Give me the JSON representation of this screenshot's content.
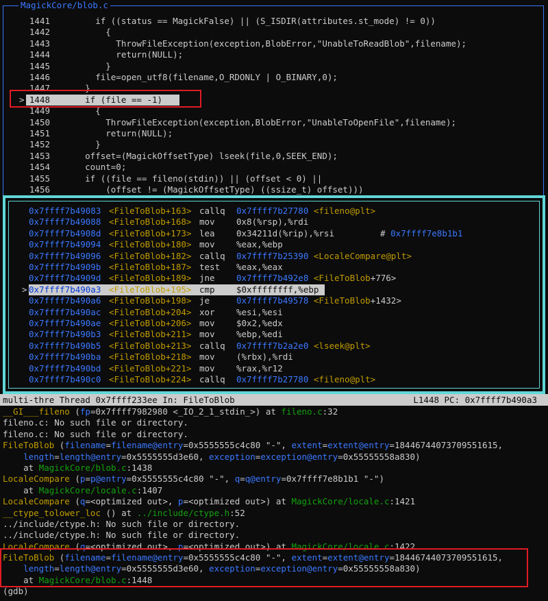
{
  "source_pane": {
    "title": "MagickCore/blob.c",
    "current_marker": ">",
    "lines": [
      {
        "num": "1441",
        "code": "        if ((status == MagickFalse) || (S_ISDIR(attributes.st_mode) != 0))"
      },
      {
        "num": "1442",
        "code": "          {"
      },
      {
        "num": "1443",
        "code": "            ThrowFileException(exception,BlobError,\"UnableToReadBlob\",filename);"
      },
      {
        "num": "1444",
        "code": "            return(NULL);"
      },
      {
        "num": "1445",
        "code": "          }"
      },
      {
        "num": "1446",
        "code": "        file=open_utf8(filename,O_RDONLY | O_BINARY,0);"
      },
      {
        "num": "1447",
        "code": "      }"
      },
      {
        "num": "1448",
        "code": "      if (file == -1)",
        "current": true
      },
      {
        "num": "1449",
        "code": "        {"
      },
      {
        "num": "1450",
        "code": "          ThrowFileException(exception,BlobError,\"UnableToOpenFile\",filename);"
      },
      {
        "num": "1451",
        "code": "          return(NULL);"
      },
      {
        "num": "1452",
        "code": "        }"
      },
      {
        "num": "1453",
        "code": "      offset=(MagickOffsetType) lseek(file,0,SEEK_END);"
      },
      {
        "num": "1454",
        "code": "      count=0;"
      },
      {
        "num": "1455",
        "code": "      if ((file == fileno(stdin)) || (offset < 0) ||"
      },
      {
        "num": "1456",
        "code": "          (offset != (MagickOffsetType) ((ssize_t) offset)))"
      }
    ]
  },
  "asm_pane": {
    "lines": [
      {
        "addr": "0x7ffff7b49083",
        "fn": "<FileToBlob+163>",
        "op": "callq",
        "target": "0x7ffff7b27780",
        "sym": "<fileno@plt>"
      },
      {
        "addr": "0x7ffff7b49088",
        "fn": "<FileToBlob+168>",
        "op": "mov",
        "args": "0x8(%rsp),%rdi"
      },
      {
        "addr": "0x7ffff7b4908d",
        "fn": "<FileToBlob+173>",
        "op": "lea",
        "args": "0x34211d(%rip),%rsi",
        "comment": "# ",
        "comment_target": "0x7ffff7e8b1b1"
      },
      {
        "addr": "0x7ffff7b49094",
        "fn": "<FileToBlob+180>",
        "op": "mov",
        "args": "%eax,%ebp"
      },
      {
        "addr": "0x7ffff7b49096",
        "fn": "<FileToBlob+182>",
        "op": "callq",
        "target": "0x7ffff7b25390",
        "sym": "<LocaleCompare@plt>"
      },
      {
        "addr": "0x7ffff7b4909b",
        "fn": "<FileToBlob+187>",
        "op": "test",
        "args": "%eax,%eax"
      },
      {
        "addr": "0x7ffff7b4909d",
        "fn": "<FileToBlob+189>",
        "op": "jne",
        "target": "0x7ffff7b492e8",
        "sym": "<FileToBlob",
        "sym_off": "+776>"
      },
      {
        "addr": "0x7ffff7b490a3",
        "fn": "<FileToBlob+195>",
        "op": "cmp",
        "args": "$0xffffffff,%ebp",
        "current": true
      },
      {
        "addr": "0x7ffff7b490a6",
        "fn": "<FileToBlob+198>",
        "op": "je",
        "target": "0x7ffff7b49578",
        "sym": "<FileToBlob",
        "sym_off": "+1432>"
      },
      {
        "addr": "0x7ffff7b490ac",
        "fn": "<FileToBlob+204>",
        "op": "xor",
        "args": "%esi,%esi"
      },
      {
        "addr": "0x7ffff7b490ae",
        "fn": "<FileToBlob+206>",
        "op": "mov",
        "args": "$0x2,%edx"
      },
      {
        "addr": "0x7ffff7b490b3",
        "fn": "<FileToBlob+211>",
        "op": "mov",
        "args": "%ebp,%edi"
      },
      {
        "addr": "0x7ffff7b490b5",
        "fn": "<FileToBlob+213>",
        "op": "callq",
        "target": "0x7ffff7b2a2e0",
        "sym": "<lseek@plt>"
      },
      {
        "addr": "0x7ffff7b490ba",
        "fn": "<FileToBlob+218>",
        "op": "mov",
        "args": "(%rbx),%rdi"
      },
      {
        "addr": "0x7ffff7b490bd",
        "fn": "<FileToBlob+221>",
        "op": "mov",
        "args": "%rax,%r12"
      },
      {
        "addr": "0x7ffff7b490c0",
        "fn": "<FileToBlob+224>",
        "op": "callq",
        "target": "0x7ffff7b27780",
        "sym": "<fileno@plt>"
      }
    ]
  },
  "status_bar": {
    "left": "multi-thre Thread 0x7ffff233ee In: FileToBlob",
    "right": "L1448 PC: 0x7ffff7b490a3"
  },
  "console": {
    "lines": [
      [
        {
          "t": "__GI___fileno",
          "c": "fnname"
        },
        {
          "t": " ("
        },
        {
          "t": "fp",
          "c": "param"
        },
        {
          "t": "=0x7ffff7982980 <_IO_2_1_stdin_>) at "
        },
        {
          "t": "fileno.c",
          "c": "file"
        },
        {
          "t": ":32"
        }
      ],
      [
        {
          "t": "fileno.c: No such file or directory."
        }
      ],
      [
        {
          "t": "fileno.c: No such file or directory."
        }
      ],
      [
        {
          "t": "FileToBlob",
          "c": "fnname"
        },
        {
          "t": " ("
        },
        {
          "t": "filename",
          "c": "param"
        },
        {
          "t": "="
        },
        {
          "t": "filename@entry",
          "c": "param"
        },
        {
          "t": "=0x5555555c4c80 \"-\", "
        },
        {
          "t": "extent",
          "c": "param"
        },
        {
          "t": "="
        },
        {
          "t": "extent@entry",
          "c": "param"
        },
        {
          "t": "=18446744073709551615,"
        }
      ],
      [
        {
          "t": "    "
        },
        {
          "t": "length",
          "c": "param"
        },
        {
          "t": "="
        },
        {
          "t": "length@entry",
          "c": "param"
        },
        {
          "t": "=0x5555555d3e60, "
        },
        {
          "t": "exception",
          "c": "param"
        },
        {
          "t": "="
        },
        {
          "t": "exception@entry",
          "c": "param"
        },
        {
          "t": "=0x55555558a830)"
        }
      ],
      [
        {
          "t": "    at "
        },
        {
          "t": "MagickCore/blob.c",
          "c": "file"
        },
        {
          "t": ":1438"
        }
      ],
      [
        {
          "t": "LocaleCompare",
          "c": "fnname"
        },
        {
          "t": " ("
        },
        {
          "t": "p",
          "c": "param"
        },
        {
          "t": "="
        },
        {
          "t": "p@entry",
          "c": "param"
        },
        {
          "t": "=0x5555555c4c80 \"-\", "
        },
        {
          "t": "q",
          "c": "param"
        },
        {
          "t": "="
        },
        {
          "t": "q@entry",
          "c": "param"
        },
        {
          "t": "=0x7ffff7e8b1b1 \"-\")"
        }
      ],
      [
        {
          "t": "    at "
        },
        {
          "t": "MagickCore/locale.c",
          "c": "file"
        },
        {
          "t": ":1407"
        }
      ],
      [
        {
          "t": "LocaleCompare",
          "c": "fnname"
        },
        {
          "t": " ("
        },
        {
          "t": "q",
          "c": "param"
        },
        {
          "t": "=<optimized out>, "
        },
        {
          "t": "p",
          "c": "param"
        },
        {
          "t": "=<optimized out>) at "
        },
        {
          "t": "MagickCore/locale.c",
          "c": "file"
        },
        {
          "t": ":1421"
        }
      ],
      [
        {
          "t": "__ctype_tolower_loc",
          "c": "fnname"
        },
        {
          "t": " () at "
        },
        {
          "t": "../include/ctype.h",
          "c": "file"
        },
        {
          "t": ":52"
        }
      ],
      [
        {
          "t": "../include/ctype.h: No such file or directory."
        }
      ],
      [
        {
          "t": "../include/ctype.h: No such file or directory."
        }
      ],
      [
        {
          "t": "LocaleCompare",
          "c": "fnname"
        },
        {
          "t": " ("
        },
        {
          "t": "q",
          "c": "param"
        },
        {
          "t": "=<optimized out>, "
        },
        {
          "t": "p",
          "c": "param"
        },
        {
          "t": "=<optimized out>) at "
        },
        {
          "t": "MagickCore/locale.c",
          "c": "file"
        },
        {
          "t": ":1422"
        }
      ],
      [
        {
          "t": "FileToBlob",
          "c": "fnname"
        },
        {
          "t": " ("
        },
        {
          "t": "filename",
          "c": "param"
        },
        {
          "t": "="
        },
        {
          "t": "filename@entry",
          "c": "param"
        },
        {
          "t": "=0x5555555c4c80 \"-\", "
        },
        {
          "t": "extent",
          "c": "param"
        },
        {
          "t": "="
        },
        {
          "t": "extent@entry",
          "c": "param"
        },
        {
          "t": "=18446744073709551615,"
        }
      ],
      [
        {
          "t": "    "
        },
        {
          "t": "length",
          "c": "param"
        },
        {
          "t": "="
        },
        {
          "t": "length@entry",
          "c": "param"
        },
        {
          "t": "=0x5555555d3e60, "
        },
        {
          "t": "exception",
          "c": "param"
        },
        {
          "t": "="
        },
        {
          "t": "exception@entry",
          "c": "param"
        },
        {
          "t": "=0x55555558a830)"
        }
      ],
      [
        {
          "t": "    at "
        },
        {
          "t": "MagickCore/blob.c",
          "c": "file"
        },
        {
          "t": ":1448"
        }
      ],
      [
        {
          "t": "(gdb) "
        }
      ]
    ]
  },
  "colors": {
    "background": "#0c0c0c",
    "text": "#cccccc",
    "source_border": "#3b78ff",
    "asm_border": "#61d6d6",
    "address": "#3b78ff",
    "function_name": "#c19c00",
    "file_name": "#13a10e",
    "annotation_box": "#e01b24"
  }
}
